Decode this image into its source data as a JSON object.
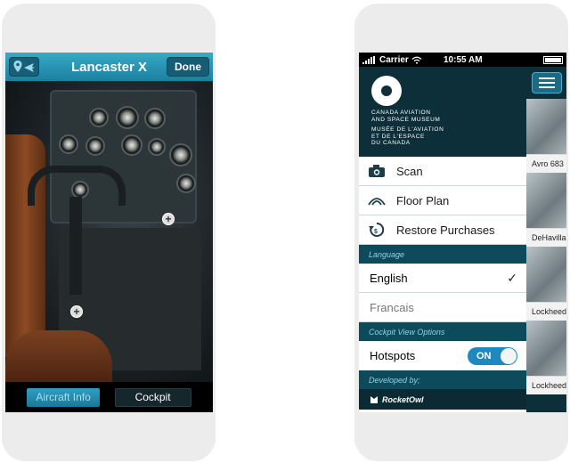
{
  "left_phone": {
    "nav": {
      "title": "Lancaster X",
      "done_label": "Done",
      "map_icon": "map-pin-plane-icon"
    },
    "tabs": [
      {
        "label": "Aircraft Info",
        "selected": false
      },
      {
        "label": "Cockpit",
        "selected": true
      }
    ],
    "hotspots": 2
  },
  "right_phone": {
    "status": {
      "carrier": "Carrier",
      "time": "10:55 AM"
    },
    "museum": {
      "en_line1": "CANADA AVIATION",
      "en_line2": "AND SPACE MUSEUM",
      "fr_line1": "MUSÉE DE L'AVIATION",
      "fr_line2": "ET DE L'ESPACE",
      "fr_line3": "DU CANADA"
    },
    "menu": [
      {
        "label": "Scan",
        "icon": "camera-icon"
      },
      {
        "label": "Floor Plan",
        "icon": "floor-plan-icon"
      },
      {
        "label": "Restore Purchases",
        "icon": "restore-icon"
      }
    ],
    "language_header": "Language",
    "languages": [
      {
        "label": "English",
        "selected": true
      },
      {
        "label": "Francais",
        "selected": false
      }
    ],
    "cockpit_header": "Cockpit View Options",
    "hotspots": {
      "label": "Hotspots",
      "state": "ON"
    },
    "developed_header": "Developed by;",
    "developer": "RocketOwl",
    "side_items": [
      {
        "caption": "Avro 683"
      },
      {
        "caption": "DeHavilla"
      },
      {
        "caption": "Lockheed"
      },
      {
        "caption": "Lockheed"
      }
    ]
  },
  "colors": {
    "accent": "#1e88c0",
    "nav": "#2a94b6",
    "panel": "#0d2f3a"
  }
}
